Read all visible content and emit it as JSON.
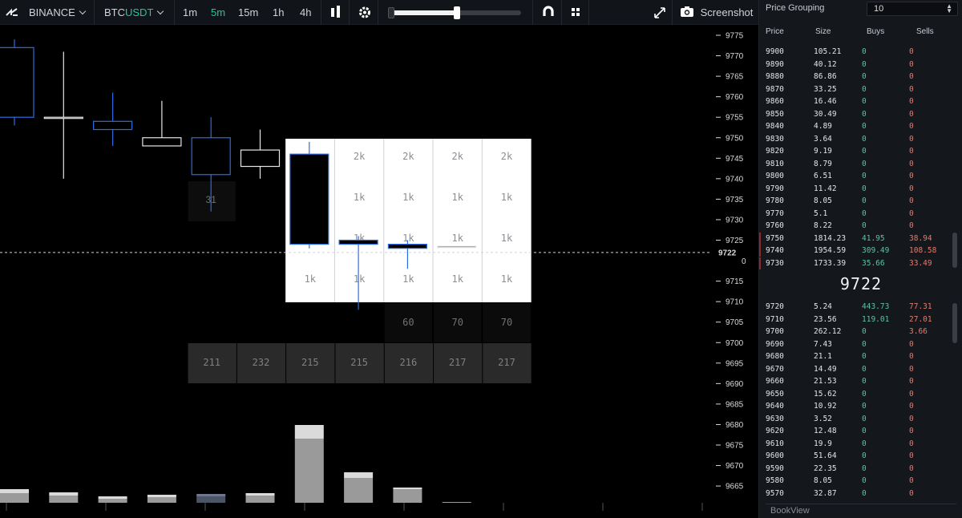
{
  "toolbar": {
    "exchange": "BINANCE",
    "symbol_base": "BTC",
    "symbol_quote": "USDT",
    "timeframes": [
      {
        "label": "1m",
        "active": false
      },
      {
        "label": "5m",
        "active": true
      },
      {
        "label": "15m",
        "active": false
      },
      {
        "label": "1h",
        "active": false
      },
      {
        "label": "4h",
        "active": false
      }
    ],
    "zoom_level": 0.52,
    "screenshot_label": "Screenshot",
    "accent_color": "#1fc99a"
  },
  "chart": {
    "price_ticks": [
      9775,
      9770,
      9765,
      9760,
      9755,
      9750,
      9745,
      9740,
      9735,
      9730,
      9725,
      9715,
      9710,
      9705,
      9700,
      9695,
      9690,
      9685,
      9680,
      9675,
      9670,
      9665
    ],
    "current_price": "9722",
    "current_price_sub": "0",
    "candles": [
      {
        "open": 9755,
        "close": 9772,
        "high": 9774,
        "low": 9753,
        "bull": true
      },
      {
        "open": 9755,
        "close": 9755,
        "high": 9771,
        "low": 9740,
        "bull": false
      },
      {
        "open": 9752,
        "close": 9754,
        "high": 9761,
        "low": 9748,
        "bull": true
      },
      {
        "open": 9748,
        "close": 9750,
        "high": 9759,
        "low": 9748,
        "bull": false
      },
      {
        "open": 9741,
        "close": 9750,
        "high": 9755,
        "low": 9732,
        "bull": true
      },
      {
        "open": 9743,
        "close": 9747,
        "high": 9752,
        "low": 9740,
        "bull": false
      },
      {
        "open": 9724,
        "close": 9746,
        "high": 9749,
        "low": 9723,
        "bull": true
      },
      {
        "open": 9724,
        "close": 9725,
        "high": 9726,
        "low": 9708,
        "bull": true
      },
      {
        "open": 9723,
        "close": 9724,
        "high": 9725,
        "low": 9718,
        "bull": true
      },
      {
        "open": 9723.5,
        "close": 9723.5,
        "high": 9723.5,
        "low": 9723.5,
        "bull": false
      }
    ],
    "footprint_cells": [
      {
        "col": 7,
        "row": 0,
        "label": "2k"
      },
      {
        "col": 8,
        "row": 0,
        "label": "2k"
      },
      {
        "col": 9,
        "row": 0,
        "label": "2k"
      },
      {
        "col": 10,
        "row": 0,
        "label": "2k"
      },
      {
        "col": 7,
        "row": 1,
        "label": "1k"
      },
      {
        "col": 8,
        "row": 1,
        "label": "1k"
      },
      {
        "col": 9,
        "row": 1,
        "label": "1k"
      },
      {
        "col": 10,
        "row": 1,
        "label": "1k"
      },
      {
        "col": 7,
        "row": 2,
        "label": "1k"
      },
      {
        "col": 8,
        "row": 2,
        "label": "1k"
      },
      {
        "col": 9,
        "row": 2,
        "label": "1k"
      },
      {
        "col": 10,
        "row": 2,
        "label": "1k"
      },
      {
        "col": 6,
        "row": 3,
        "label": "1k"
      },
      {
        "col": 7,
        "row": 3,
        "label": "1k"
      },
      {
        "col": 8,
        "row": 3,
        "label": "1k"
      },
      {
        "col": 9,
        "row": 3,
        "label": "1k"
      },
      {
        "col": 10,
        "row": 3,
        "label": "1k"
      }
    ],
    "marker_labels": [
      {
        "col": 4,
        "label": "31"
      }
    ],
    "count_row_a": [
      {
        "col": 8,
        "label": "60"
      },
      {
        "col": 9,
        "label": "70"
      },
      {
        "col": 10,
        "label": "70"
      }
    ],
    "count_row_b": [
      "211",
      "232",
      "215",
      "215",
      "216",
      "217",
      "217"
    ],
    "volume_bars": [
      {
        "total": 17,
        "sell": 5,
        "highlight": false
      },
      {
        "total": 13,
        "sell": 4,
        "highlight": false
      },
      {
        "total": 8,
        "sell": 3,
        "highlight": false
      },
      {
        "total": 10,
        "sell": 3,
        "highlight": false
      },
      {
        "total": 11,
        "sell": 3,
        "highlight": true
      },
      {
        "total": 12,
        "sell": 3,
        "highlight": false
      },
      {
        "total": 97,
        "sell": 17,
        "highlight": false
      },
      {
        "total": 38,
        "sell": 7,
        "highlight": false
      },
      {
        "total": 19,
        "sell": 2,
        "highlight": false
      },
      {
        "total": 1,
        "sell": 0,
        "highlight": false
      }
    ]
  },
  "book": {
    "grouping_label": "Price Grouping",
    "grouping_value": "10",
    "headers": {
      "price": "Price",
      "size": "Size",
      "buys": "Buys",
      "sells": "Sells"
    },
    "asks": [
      {
        "price": "9900",
        "size": "105.21",
        "buys": "0",
        "sells": "0"
      },
      {
        "price": "9890",
        "size": "40.12",
        "buys": "0",
        "sells": "0"
      },
      {
        "price": "9880",
        "size": "86.86",
        "buys": "0",
        "sells": "0"
      },
      {
        "price": "9870",
        "size": "33.25",
        "buys": "0",
        "sells": "0"
      },
      {
        "price": "9860",
        "size": "16.46",
        "buys": "0",
        "sells": "0"
      },
      {
        "price": "9850",
        "size": "30.49",
        "buys": "0",
        "sells": "0"
      },
      {
        "price": "9840",
        "size": "4.89",
        "buys": "0",
        "sells": "0"
      },
      {
        "price": "9830",
        "size": "3.64",
        "buys": "0",
        "sells": "0"
      },
      {
        "price": "9820",
        "size": "9.19",
        "buys": "0",
        "sells": "0"
      },
      {
        "price": "9810",
        "size": "8.79",
        "buys": "0",
        "sells": "0"
      },
      {
        "price": "9800",
        "size": "6.51",
        "buys": "0",
        "sells": "0"
      },
      {
        "price": "9790",
        "size": "11.42",
        "buys": "0",
        "sells": "0"
      },
      {
        "price": "9780",
        "size": "8.05",
        "buys": "0",
        "sells": "0"
      },
      {
        "price": "9770",
        "size": "5.1",
        "buys": "0",
        "sells": "0"
      },
      {
        "price": "9760",
        "size": "8.22",
        "buys": "0",
        "sells": "0"
      },
      {
        "price": "9750",
        "size": "1814.23",
        "buys": "41.95",
        "sells": "38.94",
        "hl": true
      },
      {
        "price": "9740",
        "size": "1954.59",
        "buys": "309.49",
        "sells": "108.58",
        "hl": true
      },
      {
        "price": "9730",
        "size": "1733.39",
        "buys": "35.66",
        "sells": "33.49",
        "hl": true
      }
    ],
    "mid_price": "9722",
    "bids": [
      {
        "price": "9720",
        "size": "5.24",
        "buys": "443.73",
        "sells": "77.31"
      },
      {
        "price": "9710",
        "size": "23.56",
        "buys": "119.01",
        "sells": "27.01"
      },
      {
        "price": "9700",
        "size": "262.12",
        "buys": "0",
        "sells": "3.66"
      },
      {
        "price": "9690",
        "size": "7.43",
        "buys": "0",
        "sells": "0"
      },
      {
        "price": "9680",
        "size": "21.1",
        "buys": "0",
        "sells": "0"
      },
      {
        "price": "9670",
        "size": "14.49",
        "buys": "0",
        "sells": "0"
      },
      {
        "price": "9660",
        "size": "21.53",
        "buys": "0",
        "sells": "0"
      },
      {
        "price": "9650",
        "size": "15.62",
        "buys": "0",
        "sells": "0"
      },
      {
        "price": "9640",
        "size": "10.92",
        "buys": "0",
        "sells": "0"
      },
      {
        "price": "9630",
        "size": "3.52",
        "buys": "0",
        "sells": "0"
      },
      {
        "price": "9620",
        "size": "12.48",
        "buys": "0",
        "sells": "0"
      },
      {
        "price": "9610",
        "size": "19.9",
        "buys": "0",
        "sells": "0"
      },
      {
        "price": "9600",
        "size": "51.64",
        "buys": "0",
        "sells": "0"
      },
      {
        "price": "9590",
        "size": "22.35",
        "buys": "0",
        "sells": "0"
      },
      {
        "price": "9580",
        "size": "8.05",
        "buys": "0",
        "sells": "0"
      },
      {
        "price": "9570",
        "size": "32.87",
        "buys": "0",
        "sells": "0"
      }
    ],
    "footer_label": "BookView"
  }
}
